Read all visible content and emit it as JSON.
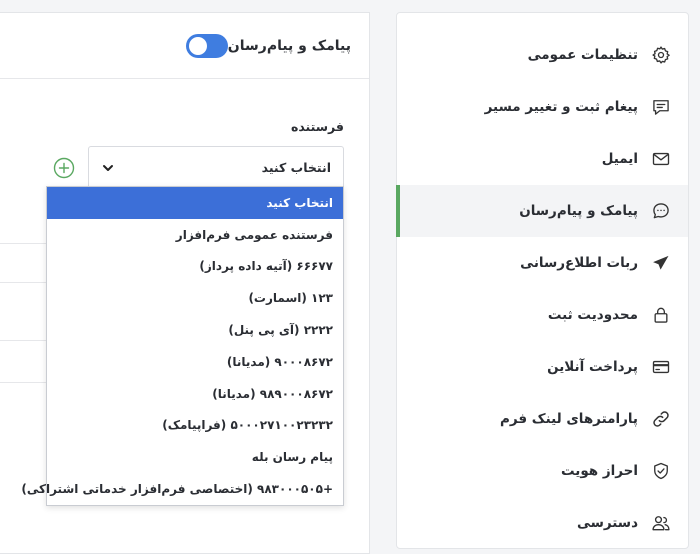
{
  "sidebar": {
    "items": [
      {
        "label": "تنظیمات عمومی",
        "icon": "gear-icon"
      },
      {
        "label": "پیغام ثبت و تغییر مسیر",
        "icon": "message-icon"
      },
      {
        "label": "ایمیل",
        "icon": "mail-icon"
      },
      {
        "label": "پیامک و پیام‌رسان",
        "icon": "chat-icon",
        "active": true
      },
      {
        "label": "ربات اطلاع‌رسانی",
        "icon": "send-icon"
      },
      {
        "label": "محدودیت ثبت",
        "icon": "lock-icon"
      },
      {
        "label": "پرداخت آنلاین",
        "icon": "credit-card-icon"
      },
      {
        "label": "پارامترهای لینک فرم",
        "icon": "link-icon"
      },
      {
        "label": "احراز هویت",
        "icon": "shield-check-icon"
      },
      {
        "label": "دسترسی",
        "icon": "users-icon"
      }
    ],
    "active_color": "#5aa861"
  },
  "panel": {
    "title": "پیامک و پیام‌رسان",
    "toggle_on": true,
    "toggle_color": "#3f7de0",
    "sender_label": "فرستنده",
    "select_value": "انتخاب کنید"
  },
  "dropdown": {
    "options": [
      "انتخاب کنید",
      "فرستنده عمومی فرم‌افزار",
      "۶۶۶۷۷ (آتیه داده پرداز)",
      "۱۲۳ (اسمارت)",
      "۲۲۲۲ (آی پی پنل)",
      "۹۰۰۰۸۶۷۲ (مدیانا)",
      "۹۸۹۰۰۰۸۶۷۲ (مدیانا)",
      "۵۰۰۰۲۷۱۰۰۲۳۲۳۲ (فراپیامک)",
      "پیام رسان بله",
      "+۹۸۳۰۰۰۵۰۵ (اختصاصی فرم‌افزار خدماتی اشتراکی)"
    ],
    "selected_color": "#3c6fd8"
  }
}
